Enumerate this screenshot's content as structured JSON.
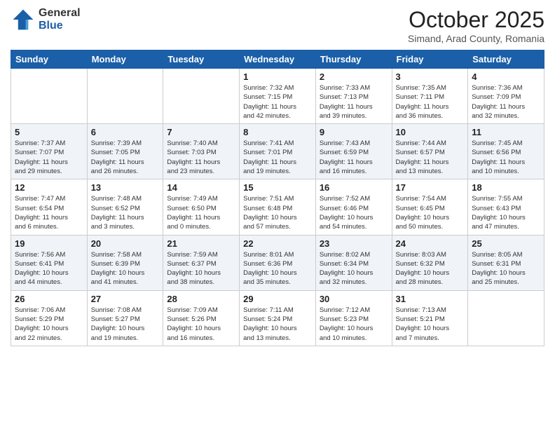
{
  "header": {
    "logo_general": "General",
    "logo_blue": "Blue",
    "month_title": "October 2025",
    "subtitle": "Simand, Arad County, Romania"
  },
  "days_of_week": [
    "Sunday",
    "Monday",
    "Tuesday",
    "Wednesday",
    "Thursday",
    "Friday",
    "Saturday"
  ],
  "weeks": [
    [
      {
        "day": "",
        "info": ""
      },
      {
        "day": "",
        "info": ""
      },
      {
        "day": "",
        "info": ""
      },
      {
        "day": "1",
        "info": "Sunrise: 7:32 AM\nSunset: 7:15 PM\nDaylight: 11 hours\nand 42 minutes."
      },
      {
        "day": "2",
        "info": "Sunrise: 7:33 AM\nSunset: 7:13 PM\nDaylight: 11 hours\nand 39 minutes."
      },
      {
        "day": "3",
        "info": "Sunrise: 7:35 AM\nSunset: 7:11 PM\nDaylight: 11 hours\nand 36 minutes."
      },
      {
        "day": "4",
        "info": "Sunrise: 7:36 AM\nSunset: 7:09 PM\nDaylight: 11 hours\nand 32 minutes."
      }
    ],
    [
      {
        "day": "5",
        "info": "Sunrise: 7:37 AM\nSunset: 7:07 PM\nDaylight: 11 hours\nand 29 minutes."
      },
      {
        "day": "6",
        "info": "Sunrise: 7:39 AM\nSunset: 7:05 PM\nDaylight: 11 hours\nand 26 minutes."
      },
      {
        "day": "7",
        "info": "Sunrise: 7:40 AM\nSunset: 7:03 PM\nDaylight: 11 hours\nand 23 minutes."
      },
      {
        "day": "8",
        "info": "Sunrise: 7:41 AM\nSunset: 7:01 PM\nDaylight: 11 hours\nand 19 minutes."
      },
      {
        "day": "9",
        "info": "Sunrise: 7:43 AM\nSunset: 6:59 PM\nDaylight: 11 hours\nand 16 minutes."
      },
      {
        "day": "10",
        "info": "Sunrise: 7:44 AM\nSunset: 6:57 PM\nDaylight: 11 hours\nand 13 minutes."
      },
      {
        "day": "11",
        "info": "Sunrise: 7:45 AM\nSunset: 6:56 PM\nDaylight: 11 hours\nand 10 minutes."
      }
    ],
    [
      {
        "day": "12",
        "info": "Sunrise: 7:47 AM\nSunset: 6:54 PM\nDaylight: 11 hours\nand 6 minutes."
      },
      {
        "day": "13",
        "info": "Sunrise: 7:48 AM\nSunset: 6:52 PM\nDaylight: 11 hours\nand 3 minutes."
      },
      {
        "day": "14",
        "info": "Sunrise: 7:49 AM\nSunset: 6:50 PM\nDaylight: 11 hours\nand 0 minutes."
      },
      {
        "day": "15",
        "info": "Sunrise: 7:51 AM\nSunset: 6:48 PM\nDaylight: 10 hours\nand 57 minutes."
      },
      {
        "day": "16",
        "info": "Sunrise: 7:52 AM\nSunset: 6:46 PM\nDaylight: 10 hours\nand 54 minutes."
      },
      {
        "day": "17",
        "info": "Sunrise: 7:54 AM\nSunset: 6:45 PM\nDaylight: 10 hours\nand 50 minutes."
      },
      {
        "day": "18",
        "info": "Sunrise: 7:55 AM\nSunset: 6:43 PM\nDaylight: 10 hours\nand 47 minutes."
      }
    ],
    [
      {
        "day": "19",
        "info": "Sunrise: 7:56 AM\nSunset: 6:41 PM\nDaylight: 10 hours\nand 44 minutes."
      },
      {
        "day": "20",
        "info": "Sunrise: 7:58 AM\nSunset: 6:39 PM\nDaylight: 10 hours\nand 41 minutes."
      },
      {
        "day": "21",
        "info": "Sunrise: 7:59 AM\nSunset: 6:37 PM\nDaylight: 10 hours\nand 38 minutes."
      },
      {
        "day": "22",
        "info": "Sunrise: 8:01 AM\nSunset: 6:36 PM\nDaylight: 10 hours\nand 35 minutes."
      },
      {
        "day": "23",
        "info": "Sunrise: 8:02 AM\nSunset: 6:34 PM\nDaylight: 10 hours\nand 32 minutes."
      },
      {
        "day": "24",
        "info": "Sunrise: 8:03 AM\nSunset: 6:32 PM\nDaylight: 10 hours\nand 28 minutes."
      },
      {
        "day": "25",
        "info": "Sunrise: 8:05 AM\nSunset: 6:31 PM\nDaylight: 10 hours\nand 25 minutes."
      }
    ],
    [
      {
        "day": "26",
        "info": "Sunrise: 7:06 AM\nSunset: 5:29 PM\nDaylight: 10 hours\nand 22 minutes."
      },
      {
        "day": "27",
        "info": "Sunrise: 7:08 AM\nSunset: 5:27 PM\nDaylight: 10 hours\nand 19 minutes."
      },
      {
        "day": "28",
        "info": "Sunrise: 7:09 AM\nSunset: 5:26 PM\nDaylight: 10 hours\nand 16 minutes."
      },
      {
        "day": "29",
        "info": "Sunrise: 7:11 AM\nSunset: 5:24 PM\nDaylight: 10 hours\nand 13 minutes."
      },
      {
        "day": "30",
        "info": "Sunrise: 7:12 AM\nSunset: 5:23 PM\nDaylight: 10 hours\nand 10 minutes."
      },
      {
        "day": "31",
        "info": "Sunrise: 7:13 AM\nSunset: 5:21 PM\nDaylight: 10 hours\nand 7 minutes."
      },
      {
        "day": "",
        "info": ""
      }
    ]
  ]
}
